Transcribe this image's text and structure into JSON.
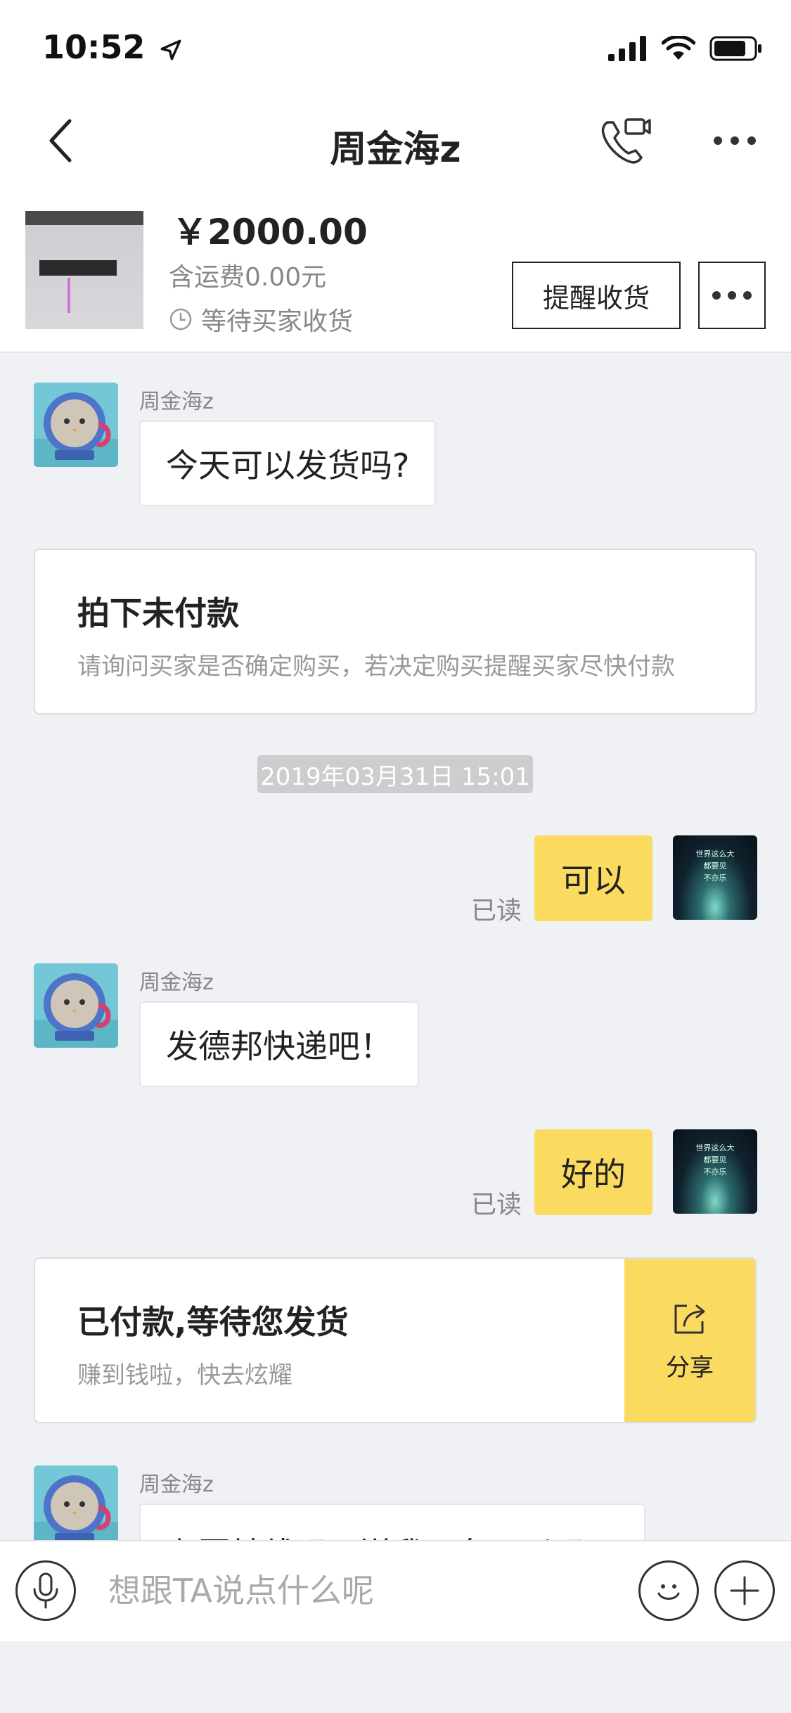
{
  "status_bar": {
    "time": "10:52"
  },
  "nav": {
    "title": "周金海z"
  },
  "product": {
    "price": "￥2000.00",
    "shipping": "含运费0.00元",
    "status": "等待买家收货",
    "remind_button": "提醒收货"
  },
  "messages": [
    {
      "sender": "周金海z",
      "text": "今天可以发货吗?"
    },
    {
      "card_title": "拍下未付款",
      "card_desc": "请询问买家是否确定购买，若决定购买提醒买家尽快付款"
    },
    {
      "timestamp": "2019年03月31日 15:01"
    },
    {
      "text": "可以",
      "read": "已读",
      "avatar_text": [
        "世界这么大",
        "都要见",
        "不亦乐"
      ]
    },
    {
      "sender": "周金海z",
      "text": "发德邦快递吧！"
    },
    {
      "text": "好的",
      "read": "已读"
    },
    {
      "card_title": "已付款,等待您发货",
      "card_desc": "赚到钱啦，快去炫耀",
      "share_label": "分享"
    },
    {
      "sender": "周金海z",
      "text": "有回轴线吗？送我一条可以吗？"
    }
  ],
  "input": {
    "placeholder": "想跟TA说点什么呢"
  },
  "colors": {
    "accent_yellow": "#fadb5f",
    "background": "#f0f1f5"
  },
  "icons": [
    "location-arrow-icon",
    "signal-icon",
    "wifi-icon",
    "battery-icon",
    "back-chevron-icon",
    "phone-video-call-icon",
    "more-dots-icon",
    "clock-icon",
    "share-icon",
    "microphone-icon",
    "emoji-icon",
    "plus-icon"
  ]
}
